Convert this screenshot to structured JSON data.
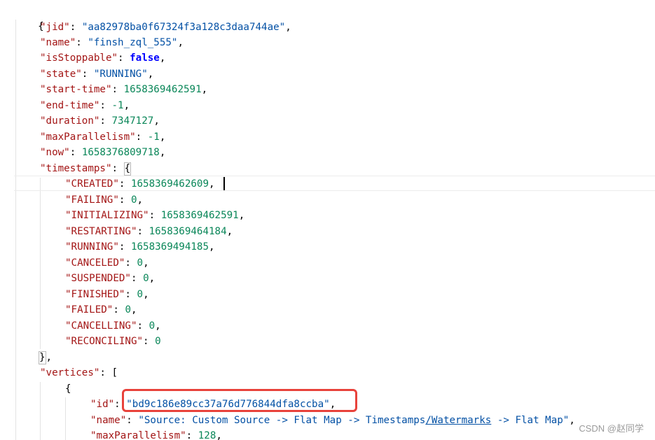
{
  "lines": {
    "open_brace": "{",
    "jid_key": "\"jid\"",
    "jid_value": "\"aa82978ba0f67324f3a128c3daa744ae\"",
    "name_key": "\"name\"",
    "name_value": "\"finsh_zql_555\"",
    "isStoppable_key": "\"isStoppable\"",
    "isStoppable_value": "false",
    "state_key": "\"state\"",
    "state_value": "\"RUNNING\"",
    "start_time_key": "\"start-time\"",
    "start_time_value": "1658369462591",
    "end_time_key": "\"end-time\"",
    "end_time_value": "-1",
    "duration_key": "\"duration\"",
    "duration_value": "7347127",
    "maxParallelism_key": "\"maxParallelism\"",
    "maxParallelism_value": "-1",
    "now_key": "\"now\"",
    "now_value": "1658376809718",
    "timestamps_key": "\"timestamps\"",
    "timestamps_open": "{",
    "created_key": "\"CREATED\"",
    "created_value": "1658369462609",
    "failing_key": "\"FAILING\"",
    "failing_value": "0",
    "initializing_key": "\"INITIALIZING\"",
    "initializing_value": "1658369462591",
    "restarting_key": "\"RESTARTING\"",
    "restarting_value": "1658369464184",
    "running_key": "\"RUNNING\"",
    "running_value": "1658369494185",
    "canceled_key": "\"CANCELED\"",
    "canceled_value": "0",
    "suspended_key": "\"SUSPENDED\"",
    "suspended_value": "0",
    "finished_key": "\"FINISHED\"",
    "finished_value": "0",
    "failed_key": "\"FAILED\"",
    "failed_value": "0",
    "cancelling_key": "\"CANCELLING\"",
    "cancelling_value": "0",
    "reconciling_key": "\"RECONCILING\"",
    "reconciling_value": "0",
    "timestamps_close": "}",
    "vertices_key": "\"vertices\"",
    "vertices_open": "[",
    "vertex_open": "{",
    "vertex_id_key": "\"id\"",
    "vertex_id_value": "\"bd9c186e89cc37a76d776844dfa8ccba\"",
    "vertex_name_key": "\"name\"",
    "vertex_name_value_part1": "\"Source: Custom Source -> Flat Map -> Timestamps",
    "vertex_name_value_part2": "/Watermarks",
    "vertex_name_value_part3": " -> Flat Map\"",
    "vertex_maxParallelism_key": "\"maxParallelism\"",
    "vertex_maxParallelism_value": "128"
  },
  "watermark": "CSDN @赵同学",
  "colors": {
    "key": "#a31515",
    "string": "#0451a5",
    "number": "#098658",
    "keyword": "#0000ff",
    "annotation": "#e8423b"
  }
}
